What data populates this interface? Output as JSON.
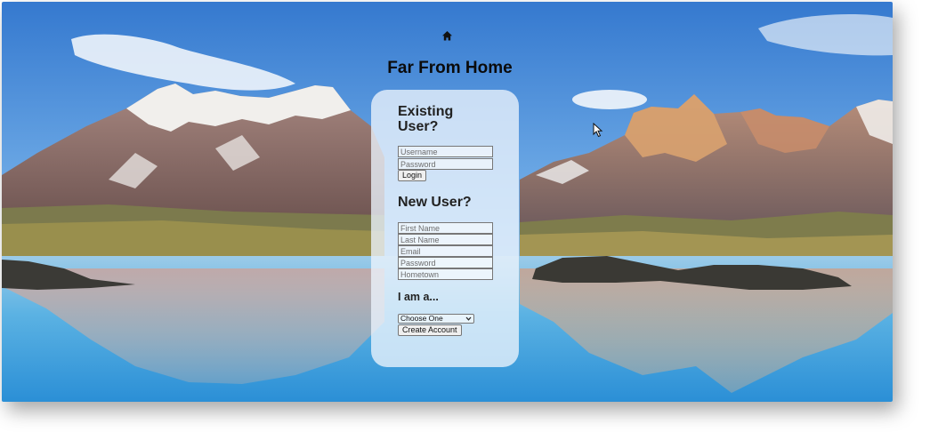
{
  "site": {
    "title": "Far From Home",
    "home_icon": "home-icon"
  },
  "existing_user": {
    "heading": "Existing User?",
    "username_placeholder": "Username",
    "password_placeholder": "Password",
    "login_label": "Login"
  },
  "new_user": {
    "heading": "New User?",
    "first_name_placeholder": "First Name",
    "last_name_placeholder": "Last Name",
    "email_placeholder": "Email",
    "password_placeholder": "Password",
    "hometown_placeholder": "Hometown",
    "role_label": "I am a...",
    "role_selected": "Choose One",
    "create_label": "Create Account"
  },
  "colors": {
    "card_bg": "#ecf4fc",
    "title_text": "#0b0b0b",
    "sky_top": "#3a7fd0",
    "lake": "#5fb6e4"
  },
  "icons": [
    "home-icon",
    "chevron-down-icon",
    "mouse-cursor-icon"
  ]
}
